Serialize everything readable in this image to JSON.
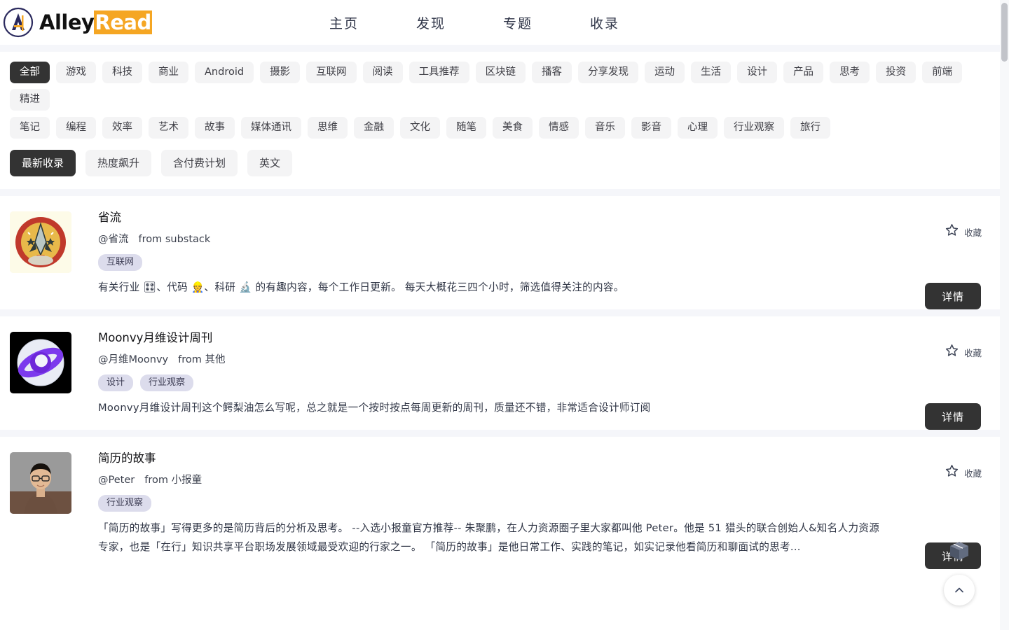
{
  "brand": {
    "name_dark": "Alley",
    "name_accent": "Read"
  },
  "nav": {
    "items": [
      {
        "label": "主页",
        "name": "nav-home"
      },
      {
        "label": "发现",
        "name": "nav-discover"
      },
      {
        "label": "专题",
        "name": "nav-topics"
      },
      {
        "label": "收录",
        "name": "nav-collection"
      }
    ]
  },
  "filters": {
    "categories_row1": [
      "全部",
      "游戏",
      "科技",
      "商业",
      "Android",
      "摄影",
      "互联网",
      "阅读",
      "工具推荐",
      "区块链",
      "播客",
      "分享发现",
      "运动",
      "生活",
      "设计",
      "产品",
      "思考",
      "投资",
      "前端",
      "精进"
    ],
    "categories_row2": [
      "笔记",
      "编程",
      "效率",
      "艺术",
      "故事",
      "媒体通讯",
      "思维",
      "金融",
      "文化",
      "随笔",
      "美食",
      "情感",
      "音乐",
      "影音",
      "心理",
      "行业观察",
      "旅行"
    ],
    "active_category": "全部",
    "sorts": [
      "最新收录",
      "热度飙升",
      "含付费计划",
      "英文"
    ],
    "active_sort": "最新收录"
  },
  "cards": [
    {
      "title": "省流",
      "handle": "@省流",
      "source_prefix": "from",
      "source": "substack",
      "tags": [
        "互联网"
      ],
      "desc": "有关行业 🎛、代码 👷、科研 🔬 的有趣内容，每个工作日更新。 每天大概花三四个小时，筛选值得关注的内容。",
      "fav_label": "收藏",
      "detail_label": "详情",
      "avatar_kind": "rocket"
    },
    {
      "title": "Moonvy月维设计周刊",
      "handle": "@月维Moonvy",
      "source_prefix": "from",
      "source": "其他",
      "tags": [
        "设计",
        "行业观察"
      ],
      "desc": "Moonvy月维设计周刊这个鳄梨油怎么写呢，总之就是一个按时按点每周更新的周刊，质量还不错，非常适合设计师订阅",
      "fav_label": "收藏",
      "detail_label": "详情",
      "avatar_kind": "planet"
    },
    {
      "title": "简历的故事",
      "handle": "@Peter",
      "source_prefix": "from",
      "source": "小报童",
      "tags": [
        "行业观察"
      ],
      "desc": "「简历的故事」写得更多的是简历背后的分析及思考。 --入选小报童官方推荐-- 朱聚鹏，在人力资源圈子里大家都叫他 Peter。他是 51 猎头的联合创始人&知名人力资源专家，也是「在行」知识共享平台职场发展领域最受欢迎的行家之一。 「简历的故事」是他日常工作、实践的笔记，如实记录他看简历和聊面试的思考...",
      "fav_label": "收藏",
      "detail_label": "详情",
      "avatar_kind": "portrait"
    }
  ],
  "floating": {
    "box_icon": "package-icon",
    "top_icon": "chevron-up-icon"
  },
  "colors": {
    "accent": "#f5a623",
    "dark_button": "#333333",
    "tag_bg": "#f4f4f5",
    "cat_pill_bg": "#dcdcec",
    "band": "#f5f6fa"
  }
}
